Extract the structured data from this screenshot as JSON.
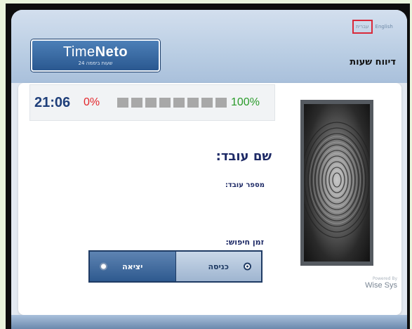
{
  "header": {
    "logo_main_light": "Time",
    "logo_main_bold": "Neto",
    "logo_tagline": "24 שעות ביממה",
    "page_title": "דיווח שעות",
    "lang_options": [
      "עברית",
      "English"
    ]
  },
  "status": {
    "clock": "21:06",
    "percent_start": "0%",
    "percent_end": "100%",
    "progress_fraction": 0.0,
    "block_count": 8
  },
  "employee": {
    "name_label": "שם עובד:",
    "number_label": "מספר עובד:",
    "search_time_label": "זמן חיפוש:"
  },
  "punch": {
    "exit_label": "יציאה",
    "entry_label": "כניסה",
    "selected": "entry"
  },
  "branding": {
    "powered_by": "Powered By",
    "company": "Wise Sys"
  },
  "colors": {
    "clock": "#1f3f7a",
    "percent_start": "#e3262b",
    "percent_end": "#2a9b2a",
    "accent": "#1f3b64",
    "lang_highlight": "#d9293a"
  },
  "icons": {
    "fingerprint": "fingerprint-image",
    "radio_exit": "radio-unselected",
    "radio_entry": "radio-selected"
  }
}
